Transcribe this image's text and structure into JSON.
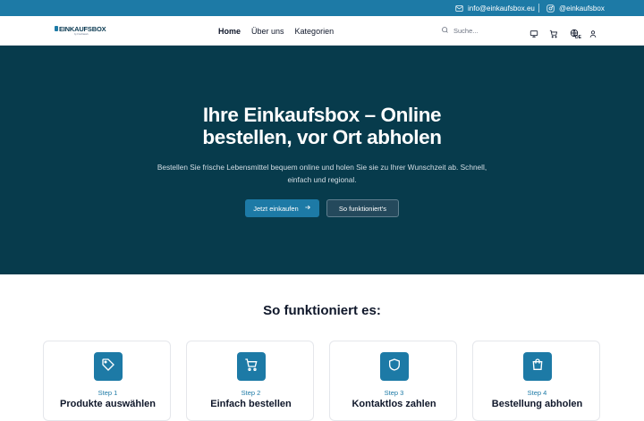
{
  "topbar": {
    "email": "info@einkaufsbox.eu",
    "instagram": "@einkaufsbox"
  },
  "logo": {
    "name": "EINKAUFSBOX",
    "tagline": "by Fruchtwerk"
  },
  "nav": {
    "links": [
      "Home",
      "Über uns",
      "Kategorien"
    ],
    "search_placeholder": "Suche...",
    "language": "DE"
  },
  "hero": {
    "title_line1": "Ihre Einkaufsbox – Online",
    "title_line2": "bestellen, vor Ort abholen",
    "subtitle_line1": "Bestellen Sie frische Lebensmittel bequem online und holen Sie sie zu Ihrer Wunschzeit ab. Schnell,",
    "subtitle_line2": "einfach und regional.",
    "primary_button": "Jetzt einkaufen",
    "secondary_button": "So funktioniert's"
  },
  "how": {
    "title": "So funktioniert es:",
    "steps": [
      {
        "step": "Step 1",
        "title": "Produkte auswählen",
        "icon": "tag-icon"
      },
      {
        "step": "Step 2",
        "title": "Einfach bestellen",
        "icon": "cart-icon"
      },
      {
        "step": "Step 3",
        "title": "Kontaktlos zahlen",
        "icon": "shield-icon"
      },
      {
        "step": "Step 4",
        "title": "Bestellung abholen",
        "icon": "shopping-bag-icon"
      }
    ]
  },
  "colors": {
    "accent": "#1d7aa6",
    "hero_bg": "#073b4c"
  }
}
